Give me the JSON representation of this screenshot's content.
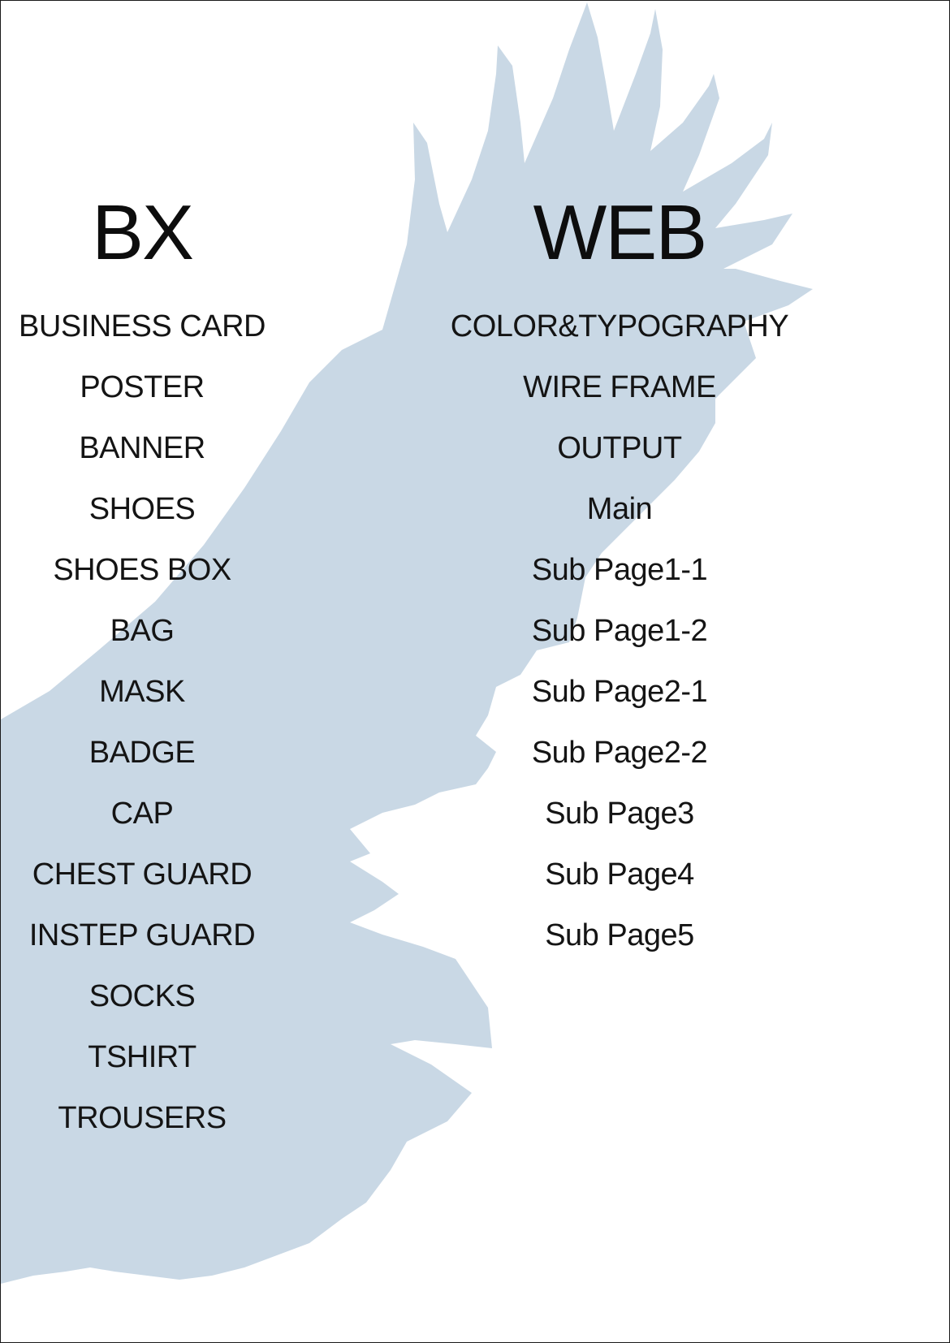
{
  "colors": {
    "background": "#ffffff",
    "silhouette": "#c9d8e5",
    "text": "#111111"
  },
  "background_image": "eagle-silhouette",
  "bx": {
    "title": "BX",
    "items": [
      "BUSINESS CARD",
      "POSTER",
      "BANNER",
      "SHOES",
      "SHOES BOX",
      "BAG",
      "MASK",
      "BADGE",
      "CAP",
      "CHEST GUARD",
      "INSTEP GUARD",
      "SOCKS",
      "TSHIRT",
      "TROUSERS"
    ]
  },
  "web": {
    "title": "WEB",
    "items": [
      "COLOR&TYPOGRAPHY",
      "WIRE FRAME",
      "OUTPUT",
      "Main",
      "Sub Page1-1",
      "Sub Page1-2",
      "Sub Page2-1",
      "Sub Page2-2",
      "Sub Page3",
      "Sub Page4",
      "Sub Page5"
    ]
  }
}
